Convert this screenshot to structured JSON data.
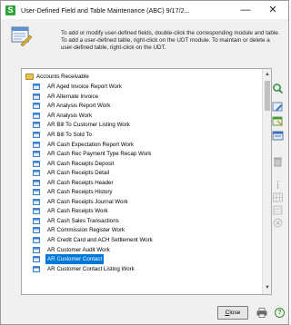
{
  "window": {
    "title": "User-Defined Field and Table Maintenance (ABC) 9/17/2...",
    "app_icon_letter": "S",
    "minimize_glyph": "—",
    "close_glyph": "✕"
  },
  "info": {
    "text": "To add or modify user-defined fields, double-click the corresponding module and table. To add a user-defined table, right-click on the UDT module. To maintain or delete a user-defined table, right-click on the UDT."
  },
  "tree": {
    "root_label": "Accounts Receivable",
    "items": [
      "AR Aged Invoice Report Work",
      "AR Alternate Invoice",
      "AR Analysis Report Work",
      "AR Analysis Work",
      "AR Bill To Customer Listing Work",
      "AR Bill To Sold To",
      "AR Cash Expectation Report Work",
      "AR Cash Rec Payment Type Recap Work",
      "AR Cash Receipts Deposit",
      "AR Cash Receipts Detail",
      "AR Cash Receipts Header",
      "AR Cash Receipts History",
      "AR Cash Receipts Journal Work",
      "AR Cash Receipts Work",
      "AR Cash Sales Transactions",
      "AR Commission Register Work",
      "AR Credit Card and ACH Settlement Work",
      "AR Customer Audit Work",
      "AR Customer Contact",
      "AR Customer Contact Listing Work"
    ],
    "selected_item": "AR Customer Contact"
  },
  "scrollbar": {
    "up_glyph": "▲",
    "down_glyph": "▼"
  },
  "toolbar": {
    "icons": [
      "search-icon",
      "edit-icon",
      "table-icon",
      "form-icon",
      "delete-icon",
      "info-icon",
      "grid-icon",
      "list-icon",
      "remove-icon"
    ]
  },
  "footer": {
    "close_u": "C",
    "close_rest": "lose",
    "help_glyph": "?"
  },
  "colors": {
    "selection": "#0078d7",
    "accent_green": "#2fa33a"
  }
}
